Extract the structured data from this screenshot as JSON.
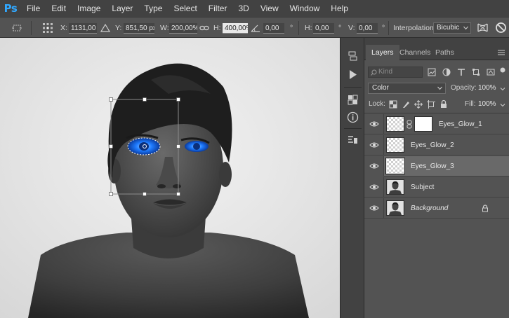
{
  "app": {
    "logo": "Ps"
  },
  "menu": [
    "File",
    "Edit",
    "Image",
    "Layer",
    "Type",
    "Select",
    "Filter",
    "3D",
    "View",
    "Window",
    "Help"
  ],
  "options": {
    "x_label": "X:",
    "x_value": "1131,00 px",
    "y_label": "Y:",
    "y_value": "851,50 px",
    "w_label": "W:",
    "w_value": "200,00%",
    "h_label": "H:",
    "h_value": "400,00%",
    "angle_value": "0,00",
    "angle_unit": "°",
    "hskew_label": "H:",
    "hskew_value": "0,00",
    "hskew_unit": "°",
    "vskew_label": "V:",
    "vskew_value": "0,00",
    "vskew_unit": "°",
    "interp_label": "Interpolation:",
    "interp_value": "Bicubic",
    "icons": [
      "transform-reference-icon",
      "delta-icon",
      "link-icon",
      "angle-icon",
      "warp-icon",
      "cancel-icon"
    ]
  },
  "strip": {
    "icons": [
      "history-icon",
      "actions-icon",
      "swatches-icon",
      "info-icon",
      "properties-icon"
    ]
  },
  "layers_panel": {
    "tabs": [
      "Layers",
      "Channels",
      "Paths"
    ],
    "active_tab": "Layers",
    "kind_placeholder": "Kind",
    "blend_mode": "Color",
    "opacity_label": "Opacity:",
    "opacity_value": "100%",
    "lock_label": "Lock:",
    "fill_label": "Fill:",
    "fill_value": "100%",
    "layers": [
      {
        "name": "Eyes_Glow_1",
        "thumb": "transparent",
        "mask": true,
        "italic": false,
        "selected": false,
        "locked": false
      },
      {
        "name": "Eyes_Glow_2",
        "thumb": "transparent",
        "mask": false,
        "italic": false,
        "selected": false,
        "locked": false
      },
      {
        "name": "Eyes_Glow_3",
        "thumb": "transparent",
        "mask": false,
        "italic": false,
        "selected": true,
        "locked": false
      },
      {
        "name": "Subject",
        "thumb": "photo",
        "mask": false,
        "italic": false,
        "selected": false,
        "locked": false
      },
      {
        "name": "Background",
        "thumb": "photo",
        "mask": false,
        "italic": true,
        "selected": false,
        "locked": true
      }
    ]
  },
  "colors": {
    "accent_ps": "#31a8ff",
    "eye_glow": "#1e7bff",
    "selected_row": "#696969"
  }
}
